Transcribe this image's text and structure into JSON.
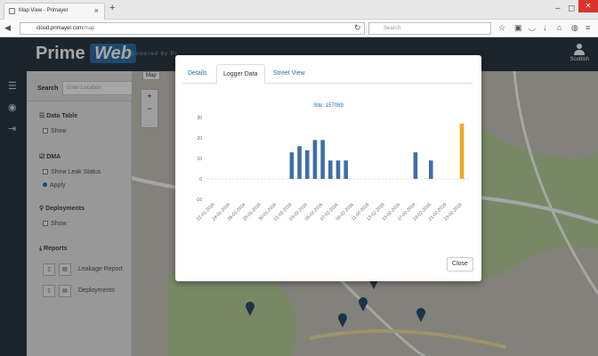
{
  "browser": {
    "tab_title": "Map View - Primayer",
    "url_host": "cloud.primayer.com",
    "url_path": "/map",
    "search_placeholder": "Search"
  },
  "app": {
    "logo_prime": "Prime",
    "logo_web": "Web",
    "powered_by": "powered by Pr",
    "user_name": "Scottish"
  },
  "panel": {
    "search_label": "Search",
    "search_placeholder": "Enter Location",
    "data_table": {
      "title": "Data Table",
      "show": "Show"
    },
    "dma": {
      "title": "DMA",
      "show_leak_status": "Show Leak Status",
      "apply": "Apply"
    },
    "deployments": {
      "title": "Deployments",
      "show": "Show"
    },
    "reports": {
      "title": "Reports",
      "leakage_report": "Leakage Report",
      "deployments": "Deployments"
    }
  },
  "map": {
    "type_label": "Map",
    "zoom_in": "+",
    "zoom_out": "−"
  },
  "modal": {
    "tabs": [
      "Details",
      "Logger Data",
      "Street View"
    ],
    "active_tab": "Logger Data",
    "close_label": "Close"
  },
  "colors": {
    "bar": "#3f6fa6",
    "highlight": "#f0a823"
  },
  "chart_data": {
    "type": "bar",
    "title": "Site: 157089",
    "y_ticks": [
      30,
      20,
      10,
      0,
      -10
    ],
    "ylim": [
      -10,
      30
    ],
    "grid": false,
    "x_tick_labels": [
      "22-01-2016",
      "24-01-2016",
      "26-01-2016",
      "28-01-2016",
      "30-01-2016",
      "01-02-2016",
      "03-02-2016",
      "05-02-2016",
      "07-02-2016",
      "09-02-2016",
      "11-02-2016",
      "13-02-2016",
      "15-02-2016",
      "17-02-2016",
      "19-02-2016",
      "21-02-2016",
      "23-02-2016"
    ],
    "bars": [
      {
        "date": "01-02-2016",
        "value": 13
      },
      {
        "date": "02-02-2016",
        "value": 16
      },
      {
        "date": "03-02-2016",
        "value": 14
      },
      {
        "date": "04-02-2016",
        "value": 19
      },
      {
        "date": "05-02-2016",
        "value": 19
      },
      {
        "date": "06-02-2016",
        "value": 9
      },
      {
        "date": "07-02-2016",
        "value": 9
      },
      {
        "date": "08-02-2016",
        "value": 9
      },
      {
        "date": "17-02-2016",
        "value": 13
      },
      {
        "date": "19-02-2016",
        "value": 9
      },
      {
        "date": "23-02-2016",
        "value": 27,
        "highlight": true
      }
    ]
  }
}
